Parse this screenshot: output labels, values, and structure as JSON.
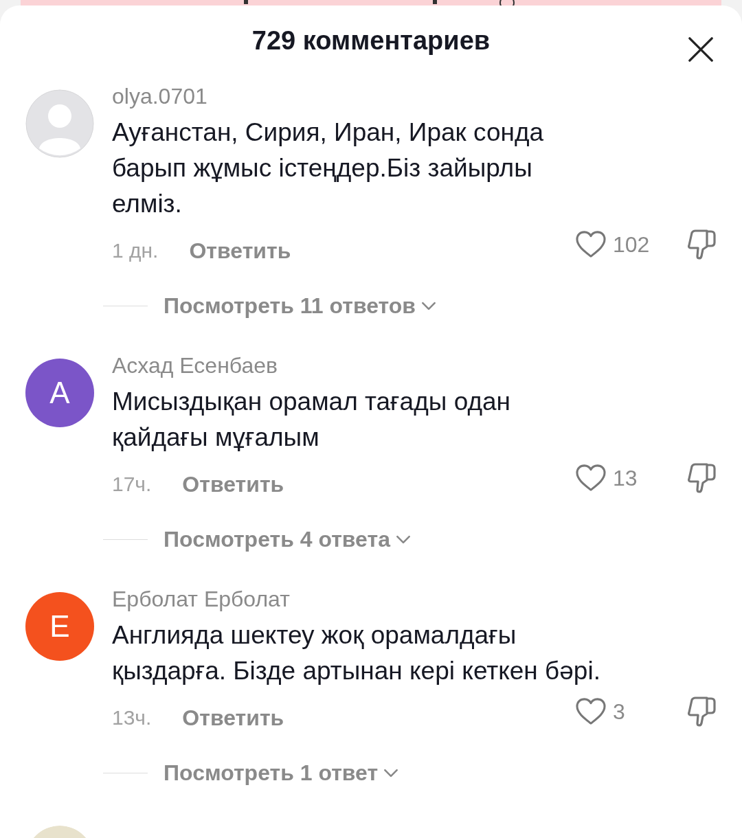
{
  "title": "729 комментариев",
  "comments": [
    {
      "avatar": {
        "kind": "default"
      },
      "name": "olya.0701",
      "text": "Ауғанстан, Сирия, Иран, Ирак сонда\nбарып жұмыс істеңдер.Біз зайырлы\nелміз.",
      "time": "1 дн.",
      "reply_label": "Ответить",
      "likes": "102",
      "replies": "Посмотреть 11 ответов"
    },
    {
      "avatar": {
        "kind": "letter",
        "letter": "А",
        "color": "#7b55c8"
      },
      "name": "Асхад Есенбаев",
      "text": "Мисыздықан орамал тағады одан\nқайдағы мұғалым",
      "time": "17ч.",
      "reply_label": "Ответить",
      "likes": "13",
      "replies": "Посмотреть 4 ответа"
    },
    {
      "avatar": {
        "kind": "letter",
        "letter": "Е",
        "color": "#f4511e"
      },
      "name": "Ерболат Ерболат",
      "text": "Англияда шектеу жоқ орамалдағы\nқыздарға. Бізде артынан кері кеткен бәрі.",
      "time": "13ч.",
      "reply_label": "Ответить",
      "likes": "3",
      "replies": "Посмотреть 1 ответ"
    },
    {
      "avatar": {
        "kind": "picture"
      }
    }
  ]
}
